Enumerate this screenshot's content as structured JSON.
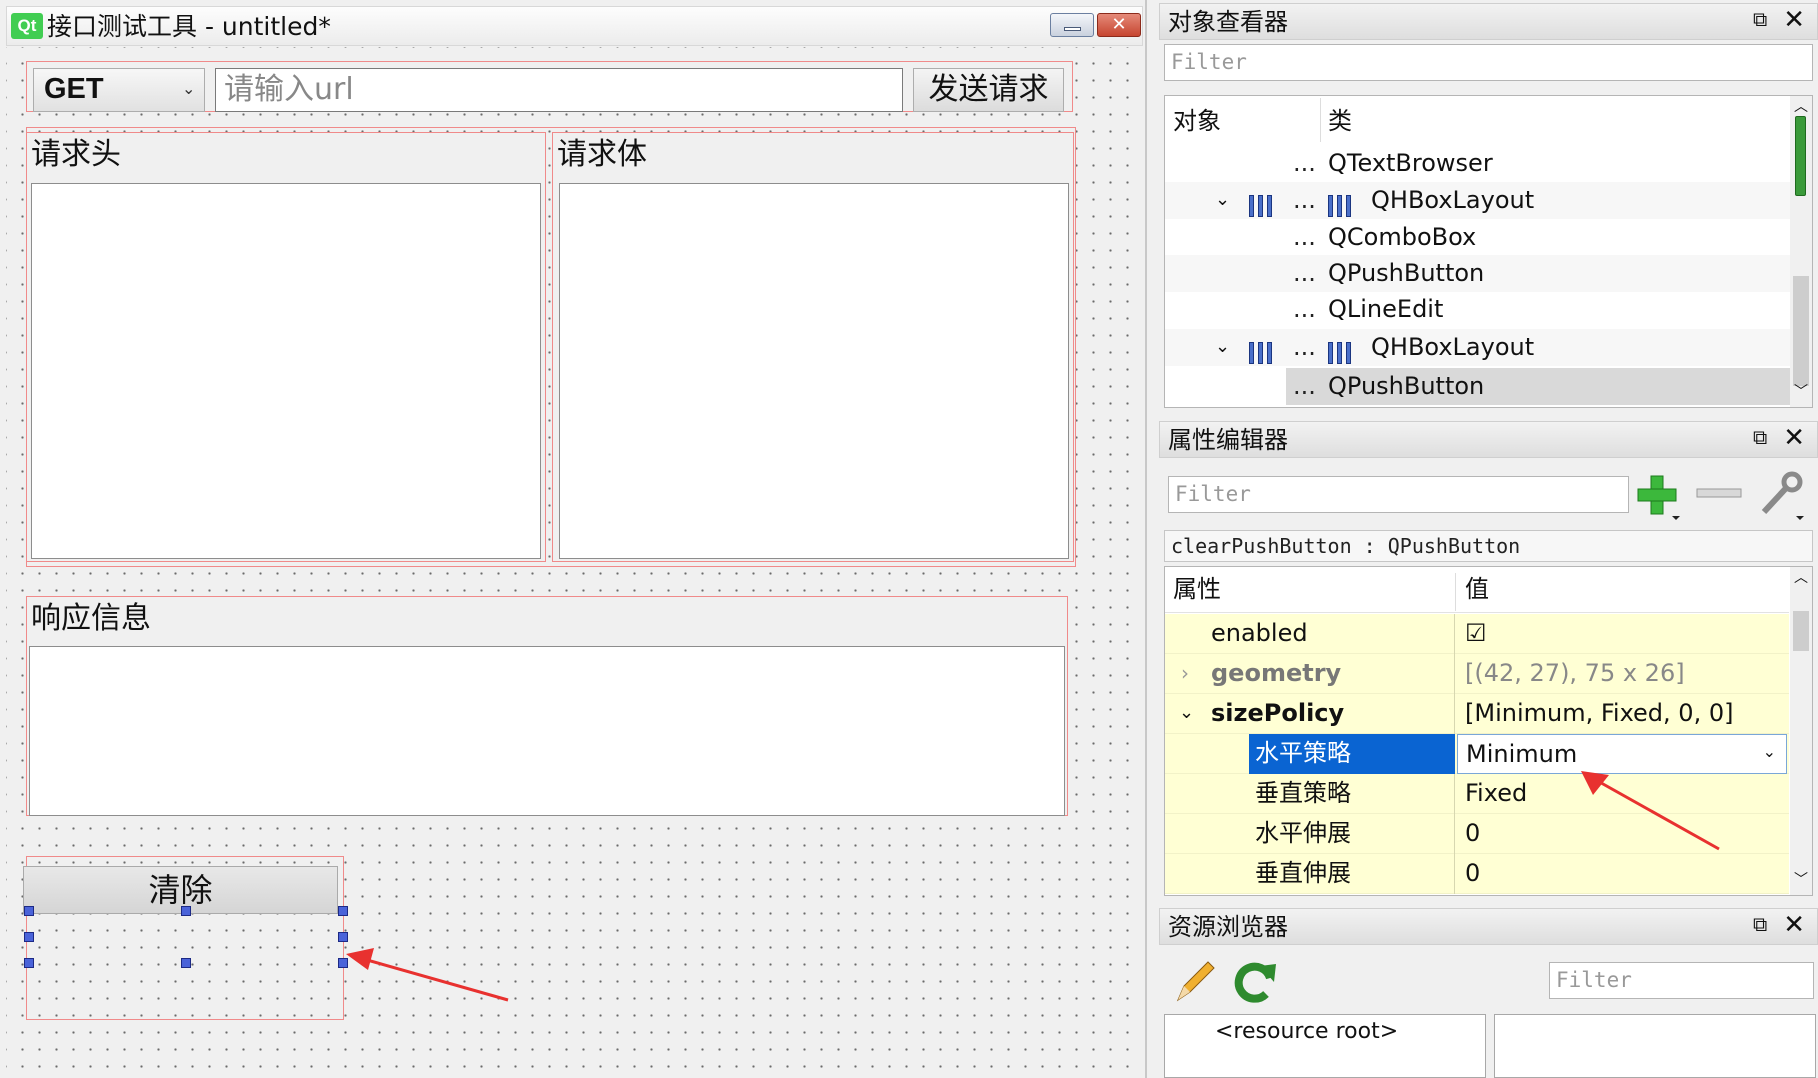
{
  "window": {
    "logo_text": "Qt",
    "title": "接口测试工具 - untitled*",
    "close_glyph": "✕"
  },
  "form": {
    "method": "GET",
    "url_placeholder": "请输入url",
    "send_label": "发送请求",
    "headers_title": "请求头",
    "body_title": "请求体",
    "response_title": "响应信息",
    "clear_label": "清除"
  },
  "object_inspector": {
    "title": "对象查看器",
    "filter_placeholder": "Filter",
    "col_object": "对象",
    "col_class": "类",
    "rows": [
      {
        "dots": "...",
        "class": "QTextBrowser"
      },
      {
        "dots": "...",
        "class": "QHBoxLayout"
      },
      {
        "dots": "...",
        "class": "QComboBox"
      },
      {
        "dots": "...",
        "class": "QPushButton"
      },
      {
        "dots": "...",
        "class": "QLineEdit"
      },
      {
        "dots": "...",
        "class": "QHBoxLayout"
      },
      {
        "dots": "...",
        "class": "QPushButton"
      }
    ]
  },
  "property_editor": {
    "title": "属性编辑器",
    "filter_placeholder": "Filter",
    "object_label": "clearPushButton : QPushButton",
    "col_property": "属性",
    "col_value": "值",
    "rows": [
      {
        "name": "enabled",
        "value": "☑"
      },
      {
        "name": "geometry",
        "value": "[(42, 27), 75 x 26]"
      },
      {
        "name": "sizePolicy",
        "value": "[Minimum, Fixed, 0, 0]"
      },
      {
        "name": "水平策略",
        "value": "Minimum"
      },
      {
        "name": "垂直策略",
        "value": "Fixed"
      },
      {
        "name": "水平伸展",
        "value": "0"
      },
      {
        "name": "垂直伸展",
        "value": "0"
      }
    ]
  },
  "resource_browser": {
    "title": "资源浏览器",
    "filter_placeholder": "Filter",
    "root_label": "<resource root>"
  },
  "dock_close_glyph": "✕",
  "dock_float_glyph": "⧉",
  "colors": {
    "selection": "#0a64d2",
    "property_row": "#ffffd4",
    "annotation_arrow": "#e8312f",
    "layout_border": "#f08a8a",
    "qt_green": "#41cd52"
  }
}
